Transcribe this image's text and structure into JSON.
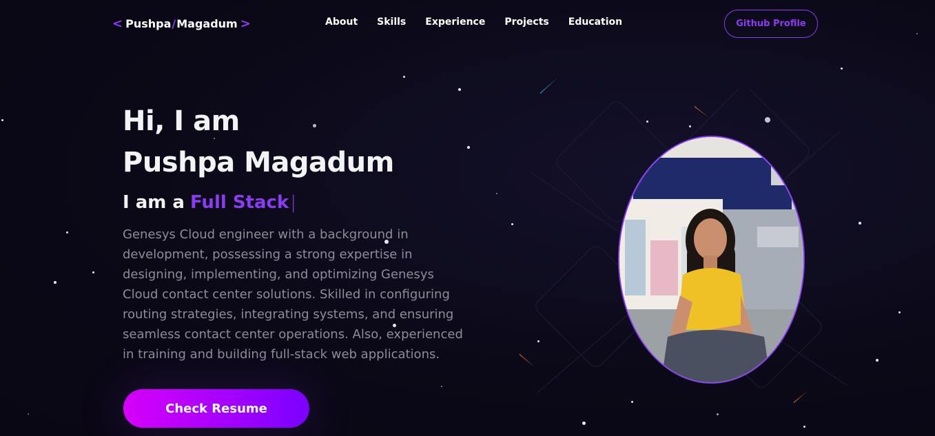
{
  "nav": {
    "logo": {
      "first": "Pushpa",
      "last": "Magadum",
      "left_bracket": "<",
      "slash": "/",
      "right_bracket": ">"
    },
    "links": [
      {
        "label": "About"
      },
      {
        "label": "Skills"
      },
      {
        "label": "Experience"
      },
      {
        "label": "Projects"
      },
      {
        "label": "Education"
      }
    ],
    "github_label": "Github Profile"
  },
  "hero": {
    "greeting": "Hi, I am",
    "name": "Pushpa Magadum",
    "role_prefix": "I am a",
    "role_typed": "Full Stack",
    "cursor": "|",
    "description": "Genesys Cloud engineer with a background in development, possessing a strong expertise in designing, implementing, and optimizing Genesys Cloud contact center solutions. Skilled in configuring routing strategies, integrating systems, and ensuring seamless contact center operations. Also, experienced in training and building full-stack web applications.",
    "cta_label": "Check Resume"
  },
  "colors": {
    "background": "#0b0917",
    "accent": "#8a3cf0",
    "text": "#f2f3f4",
    "muted_text": "#8d8d96",
    "cta_gradient_start": "#d500f9",
    "cta_gradient_end": "#7a00ff"
  },
  "icons": {
    "logo_brackets": "angle-brackets-icon"
  }
}
